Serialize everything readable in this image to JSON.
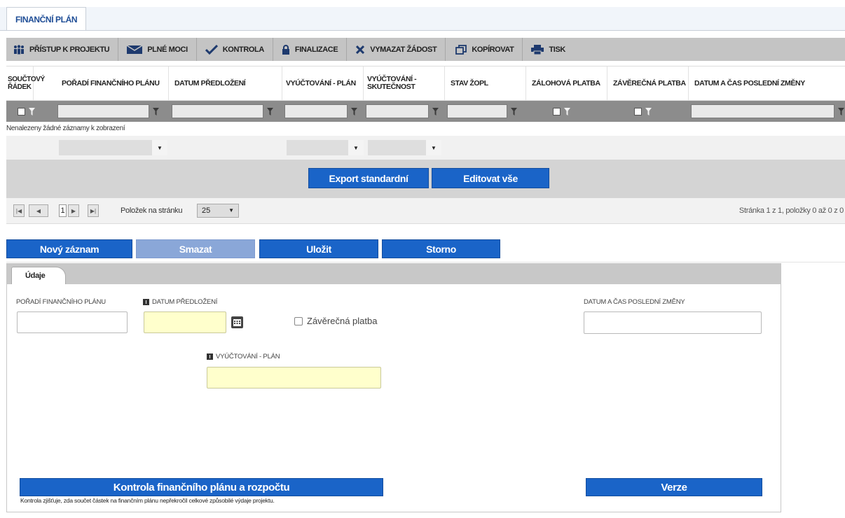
{
  "title_tab": "FINANČNÍ PLÁN",
  "toolbar": {
    "items": [
      {
        "label": "PŘÍSTUP K PROJEKTU",
        "icon": "people-icon"
      },
      {
        "label": "PLNÉ MOCI",
        "icon": "envelope-icon"
      },
      {
        "label": "KONTROLA",
        "icon": "check-icon"
      },
      {
        "label": "FINALIZACE",
        "icon": "lock-icon"
      },
      {
        "label": "VYMAZAT ŽÁDOST",
        "icon": "cross-icon"
      },
      {
        "label": "KOPÍROVAT",
        "icon": "copy-icon"
      },
      {
        "label": "TISK",
        "icon": "printer-icon"
      }
    ]
  },
  "grid": {
    "columns": [
      "SOUČTOVÝ ŘÁDEK",
      "POŘADÍ FINANČNÍHO PLÁNU",
      "DATUM PŘEDLOŽENÍ",
      "VYÚČTOVÁNÍ - PLÁN",
      "VYÚČTOVÁNÍ - SKUTEČNOST",
      "STAV ŽOPL",
      "ZÁLOHOVÁ PLATBA",
      "ZÁVĚREČNÁ PLATBA",
      "DATUM A ČAS POSLEDNÍ ZMĚNY"
    ],
    "empty_message": "Nenalezeny žádné záznamy k zobrazení"
  },
  "export": {
    "standard_label": "Export standardní",
    "edit_all_label": "Editovat vše"
  },
  "pager": {
    "current_page": "1",
    "page_size_label": "Položek na stránku",
    "page_size_value": "25",
    "info": "Stránka 1 z 1, položky 0 až 0 z 0"
  },
  "actions": {
    "new_label": "Nový záznam",
    "delete_label": "Smazat",
    "save_label": "Uložit",
    "cancel_label": "Storno"
  },
  "form": {
    "tab_label": "Údaje",
    "poradi_label": "POŘADÍ FINANČNÍHO PLÁNU",
    "datum_predlozeni_label": "DATUM PŘEDLOŽENÍ",
    "zaverecna_platba_label": "Závěrečná platba",
    "datum_zmeny_label": "DATUM A ČAS POSLEDNÍ ZMĚNY",
    "vyuctovani_plan_label": "VYÚČTOVÁNÍ - PLÁN",
    "kontrola_label": "Kontrola finančního plánu a rozpočtu",
    "verze_label": "Verze",
    "note": "Kontrola zjišťuje, zda součet částek na finančním plánu nepřekročil celkové způsobilé výdaje projektu."
  },
  "colors": {
    "accent_blue": "#1a64c8",
    "disabled_blue": "#8aa7d8",
    "required_field": "#ffffcc",
    "title_blue": "#1e4d96"
  }
}
